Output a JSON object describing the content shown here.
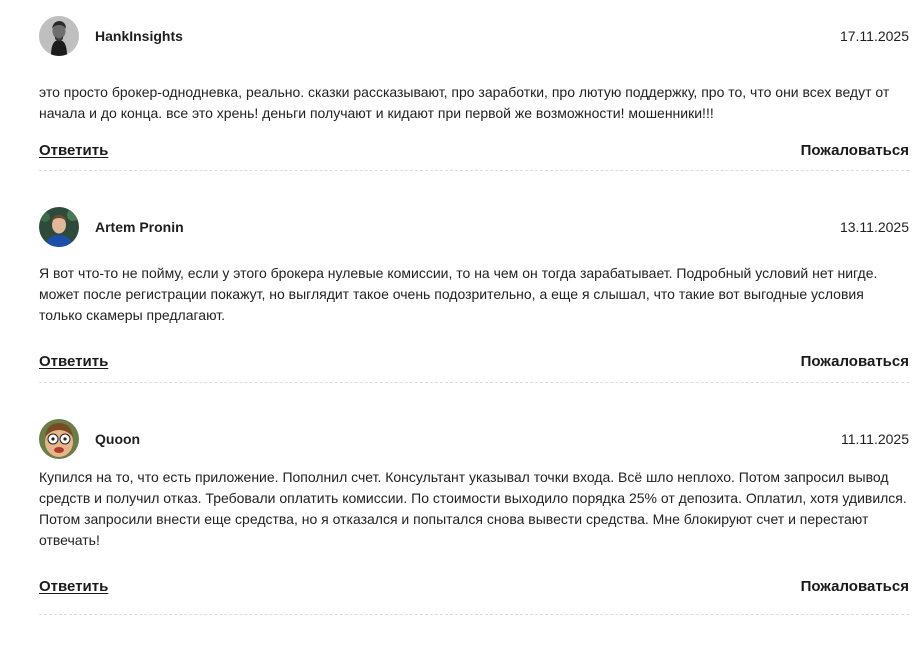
{
  "comments": [
    {
      "author": "HankInsights",
      "date": "17.11.2025",
      "avatar_icon": "avatar-bw-man-icon",
      "text": "это просто брокер-однодневка, реально. сказки рассказывают, про заработки, про лютую поддержку, про то, что они всех ведут от начала и до конца. все это хрень! деньги получают и кидают при первой же возможности! мошенники!!!",
      "reply_label": "Ответить",
      "report_label": "Пожаловаться"
    },
    {
      "author": "Artem Pronin",
      "date": "13.11.2025",
      "avatar_icon": "avatar-man-blue-shirt-icon",
      "text": "Я вот что-то не пойму, если у этого брокера нулевые комиссии, то на чем он тогда зарабатывает. Подробный условий нет нигде. может после регистрации покажут, но выглядит такое очень подозрительно, а еще я слышал, что такие вот выгодные условия только скамеры предлагают.",
      "reply_label": "Ответить",
      "report_label": "Пожаловаться"
    },
    {
      "author": "Quoon",
      "date": "11.11.2025",
      "avatar_icon": "avatar-cartoon-face-icon",
      "text": "Купился на то, что есть приложение. Пополнил счет. Консультант указывал точки входа. Всё шло неплохо. Потом запросил вывод средств и получил отказ. Требовали оплатить комиссии. По стоимости выходило порядка 25% от депозита. Оплатил, хотя удивился. Потом запросили внести еще средства, но я отказался и попытался снова вывести средства. Мне блокируют счет и перестают отвечать!",
      "reply_label": "Ответить",
      "report_label": "Пожаловаться"
    }
  ]
}
